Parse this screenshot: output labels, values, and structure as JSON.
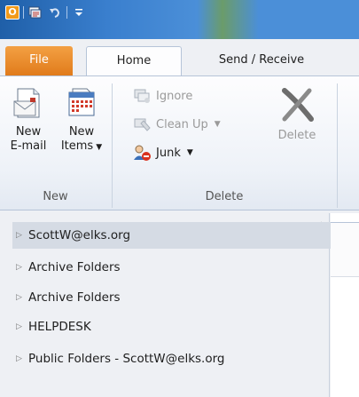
{
  "quick_access": {
    "app_icon": "outlook-icon",
    "app_letter": "O",
    "items": [
      "send-receive-all-icon",
      "undo-icon",
      "customize-qat-icon"
    ]
  },
  "tabs": {
    "file": "File",
    "home": "Home",
    "send_receive": "Send / Receive"
  },
  "ribbon": {
    "new_group": {
      "label": "New",
      "new_email": {
        "line1": "New",
        "line2": "E-mail"
      },
      "new_items": {
        "line1": "New",
        "line2": "Items"
      }
    },
    "delete_group": {
      "label": "Delete",
      "ignore": "Ignore",
      "clean_up": "Clean Up",
      "junk": "Junk",
      "delete": "Delete"
    }
  },
  "nav_pane": {
    "collapse_glyph": "<",
    "items": [
      {
        "label": "ScottW@elks.org",
        "selected": true
      },
      {
        "label": "Archive Folders"
      },
      {
        "label": "Archive Folders"
      },
      {
        "label": "HELPDESK"
      },
      {
        "label": "Public Folders - ScottW@elks.org"
      }
    ]
  },
  "colors": {
    "accent_file_tab": "#e07a1a",
    "title_bar": "#3a7fce",
    "selected_item": "#d5dbe4"
  }
}
